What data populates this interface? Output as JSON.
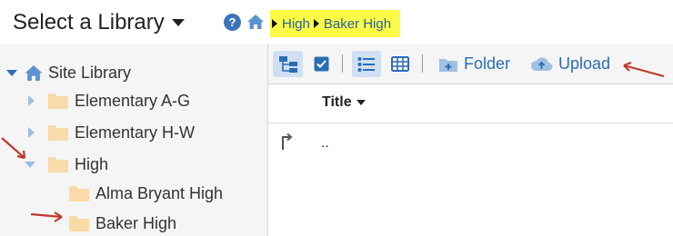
{
  "header": {
    "library_select_label": "Select a Library",
    "breadcrumbs": [
      "High",
      "Baker High"
    ],
    "highlight_color": "#fbfb45",
    "icons": [
      "help-icon",
      "home-icon"
    ]
  },
  "tree": {
    "root": {
      "label": "Site Library",
      "icon": "home-icon",
      "expanded": true
    },
    "items": [
      {
        "label": "Elementary A-G",
        "expanded": false
      },
      {
        "label": "Elementary H-W",
        "expanded": false
      },
      {
        "label": "High",
        "expanded": true
      },
      {
        "label": "Alma Bryant High"
      },
      {
        "label": "Baker High"
      }
    ]
  },
  "toolbar": {
    "folder_label": "Folder",
    "upload_label": "Upload",
    "accent_color": "#2a6db5"
  },
  "table": {
    "columns": [
      "Title"
    ],
    "rows": [
      {
        "name": ".."
      }
    ]
  },
  "annotation_color": "#c0392b"
}
